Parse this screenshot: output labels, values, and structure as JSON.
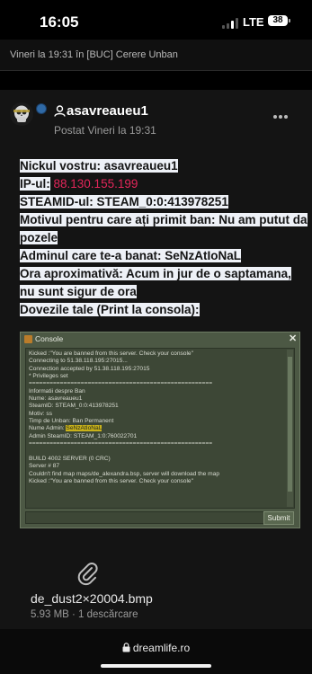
{
  "status_bar": {
    "time": "16:05",
    "network": "LTE",
    "battery": "38"
  },
  "topic": {
    "title": "Vineri la 19:31 în [BUC] Cerere Unban"
  },
  "post": {
    "author": "asavreaueu1",
    "posted": "Postat Vineri la 19:31",
    "lines": {
      "nick": "Nickul vostru: asavreaueu1",
      "ip_label": "IP-ul:",
      "ip_value": "88.130.155.199",
      "steamid": "STEAMID-ul: STEAM_0:0:413978251",
      "reason": "Motivul pentru care ați primit ban: Nu am putut da pozele",
      "admin": "Adminul care te-a banat: SeNzAtIoNaL",
      "time": "Ora aproximativă: Acum in jur de o saptamana, nu sunt sigur de ora",
      "proof": "Dovezile tale (Print la consola):"
    }
  },
  "console": {
    "title": "Console",
    "close": "✕",
    "lines": [
      "Kicked :\"You are banned from this server. Check your console\"",
      "Connecting to 51.38.118.195:27015...",
      "Connection accepted by 51.38.118.195:27015",
      "* Privileges set",
      "=====================================================",
      "Informatii despre Ban",
      "Nume: asavreaueu1",
      "SteamID: STEAM_0:0:413978251",
      "Motiv: ss",
      "Timp de Unban: Ban Permanent",
      "Nume Admin:",
      "Admin SteamID: STEAM_1:0:760022701",
      "=====================================================",
      "",
      "BUILD 4002 SERVER (0 CRC)",
      "Server # 87",
      "Couldn't find map maps/de_alexandra.bsp, server will download the map",
      "Kicked :\"You are banned from this server. Check your console\""
    ],
    "admin_highlight": "SeNzAtIoNaL",
    "submit": "Submit"
  },
  "attachment": {
    "name": "de_dust2×20004.bmp",
    "meta": "5.93 MB · 1 descărcare"
  },
  "browser": {
    "url": "dreamlife.ro"
  }
}
